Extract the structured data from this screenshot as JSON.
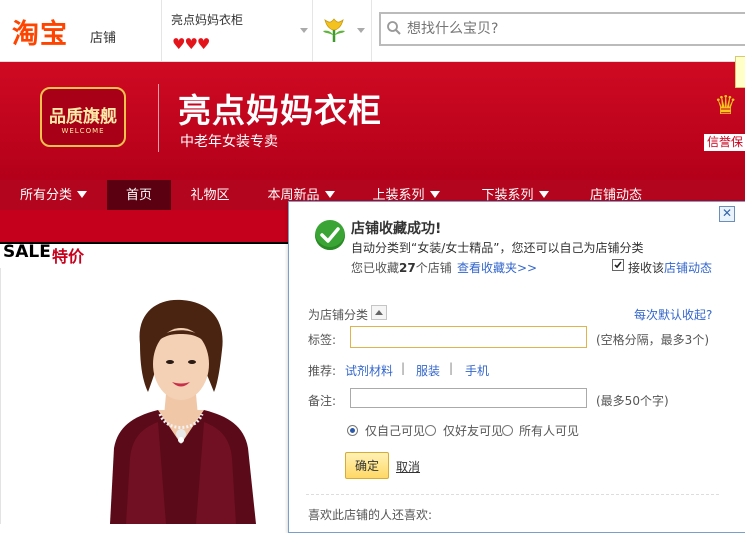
{
  "header": {
    "logo": "淘宝",
    "logo_sub": "店铺",
    "shop_title": "亮点妈妈衣柜",
    "rating_hearts": "♥♥♥",
    "search_placeholder": "想找什么宝贝?"
  },
  "banner": {
    "badge_text": "品质旗舰",
    "badge_welcome": "WELCOME",
    "store_name": "亮点妈妈衣柜",
    "store_slogan": "中老年女装专卖",
    "credit_label": "信誉保"
  },
  "nav": {
    "items": [
      {
        "label": "所有分类",
        "has_dropdown": true
      },
      {
        "label": "首页",
        "active": true
      },
      {
        "label": "礼物区"
      },
      {
        "label": "本周新品",
        "has_dropdown": true
      },
      {
        "label": "上装系列",
        "has_dropdown": true
      },
      {
        "label": "下装系列",
        "has_dropdown": true
      },
      {
        "label": "店铺动态"
      }
    ]
  },
  "sale": {
    "title_en": "SALE",
    "title_cn": "特价"
  },
  "popup": {
    "success_title": "店铺收藏成功!",
    "auto_category_text": "自动分类到“女装/女士精品”，您还可以自己为店铺分类",
    "count_prefix": "您已收藏",
    "count_value": "27",
    "count_suffix": "个店铺",
    "view_favorites": "查看收藏夹>>",
    "receive_label": "接收该",
    "receive_link": "店铺动态",
    "receive_checked": true,
    "category_label": "为店铺分类",
    "default_collapse": "每次默认收起?",
    "tag_label": "标签:",
    "tag_value": "",
    "tag_hint": "(空格分隔，最多3个)",
    "recommend_label": "推荐:",
    "recommend_items": [
      "试剂材料",
      "服装",
      "手机"
    ],
    "recommend_sep": "|",
    "note_label": "备注:",
    "note_value": "",
    "note_hint": "(最多50个字)",
    "visibility_options": [
      "仅自己可见",
      "仅好友可见",
      "所有人可见"
    ],
    "visibility_selected": "仅自己可见",
    "confirm_label": "确定",
    "cancel_label": "取消",
    "also_likes": "喜欢此店铺的人还喜欢:",
    "close_symbol": "✕"
  },
  "colors": {
    "brand_red": "#c8001c",
    "taobao_orange": "#ff4400",
    "link_blue": "#3366cc",
    "success_green": "#3aa535"
  }
}
